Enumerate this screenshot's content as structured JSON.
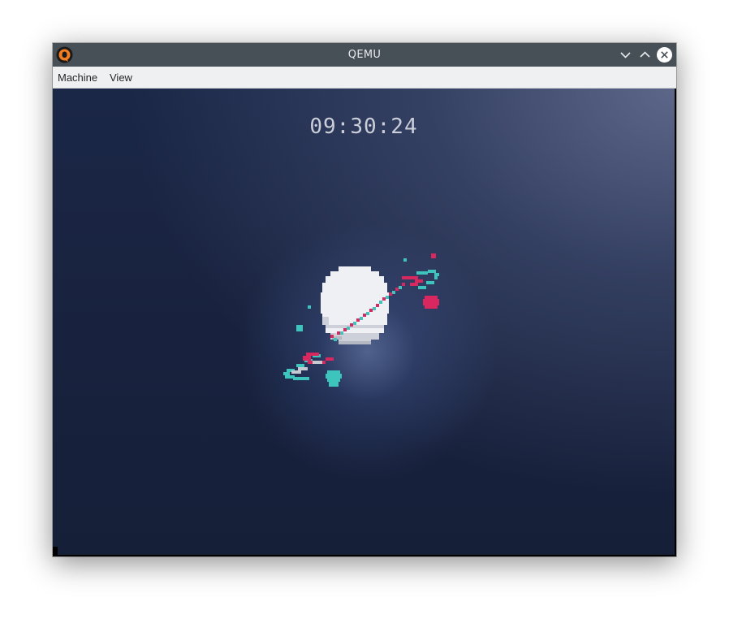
{
  "window": {
    "title": "QEMU",
    "app_icon": "qemu-logo-icon",
    "controls": {
      "minimize_icon": "chevron-down-icon",
      "maximize_icon": "chevron-up-icon",
      "close_icon": "close-icon"
    }
  },
  "menubar": {
    "items": [
      {
        "label": "Machine"
      },
      {
        "label": "View"
      }
    ]
  },
  "screen": {
    "clock": "09:30:24",
    "illustration_icon": "planet-ring-icon"
  },
  "colors": {
    "titlebar": "#475057",
    "menubar": "#eff0f1",
    "screen_bg": "#18223e",
    "planet": "#eef0f4",
    "ring_pink": "#d8285f",
    "ring_teal": "#3cc4bd"
  }
}
